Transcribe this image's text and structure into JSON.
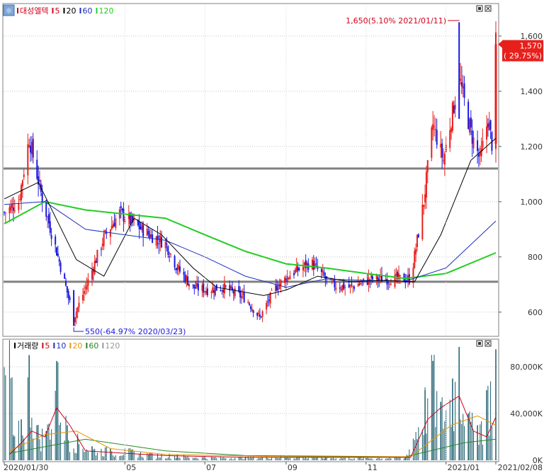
{
  "price_panel": {
    "legend": [
      {
        "label": "대성엘텍",
        "color": "#d0021b"
      },
      {
        "label": "5",
        "color": "#d0021b"
      },
      {
        "label": "20",
        "color": "#000000"
      },
      {
        "label": "60",
        "color": "#1f2fbf"
      },
      {
        "label": "120",
        "color": "#22cc22"
      }
    ],
    "y_ticks": [
      "1,600",
      "1,400",
      "1,200",
      "1,000",
      "800",
      "600"
    ],
    "high_annotation": "1,650(5.10% 2021/01/11)",
    "low_annotation": "550(-64.97% 2020/03/23)",
    "current_price": "1,570",
    "current_change": "( 29.75%)",
    "colors": {
      "up": "#e8201c",
      "down": "#1a1ae0",
      "ma5": "#d0021b",
      "ma20": "#000000",
      "ma60": "#1f2fbf",
      "ma120": "#22cc22",
      "support_line": "#808080"
    }
  },
  "volume_panel": {
    "legend": [
      {
        "label": "거래량",
        "color": "#000000"
      },
      {
        "label": "5",
        "color": "#d0021b"
      },
      {
        "label": "10",
        "color": "#1f2fbf"
      },
      {
        "label": "20",
        "color": "#e69500"
      },
      {
        "label": "60",
        "color": "#228b22"
      },
      {
        "label": "120",
        "color": "#999999"
      }
    ],
    "y_ticks": [
      "80,000K",
      "40,000K",
      "0K"
    ]
  },
  "x_axis": {
    "ticks": [
      "2020/01/30",
      "05",
      "07",
      "09",
      "11",
      "2021/01",
      "2021/02/08"
    ]
  },
  "chart_data": {
    "type": "candlestick",
    "title": "대성엘텍",
    "x_range": [
      "2020/01/30",
      "2021/02/08"
    ],
    "y_range": [
      520,
      1710
    ],
    "horizontal_lines": [
      1120,
      710
    ],
    "high": {
      "value": 1650,
      "date": "2021/01/11",
      "change_pct": 5.1
    },
    "low": {
      "value": 550,
      "date": "2020/03/23",
      "change_pct": -64.97
    },
    "last": {
      "value": 1570,
      "change_pct": 29.75
    },
    "price_path": [
      {
        "date": "2020/01/30",
        "close": 960
      },
      {
        "date": "2020/02/10",
        "close": 1000
      },
      {
        "date": "2020/02/18",
        "close": 1230
      },
      {
        "date": "2020/02/28",
        "close": 1010
      },
      {
        "date": "2020/03/10",
        "close": 820
      },
      {
        "date": "2020/03/23",
        "close": 580
      },
      {
        "date": "2020/04/02",
        "close": 700
      },
      {
        "date": "2020/04/15",
        "close": 870
      },
      {
        "date": "2020/04/27",
        "close": 960
      },
      {
        "date": "2020/05/08",
        "close": 920
      },
      {
        "date": "2020/05/20",
        "close": 880
      },
      {
        "date": "2020/06/01",
        "close": 850
      },
      {
        "date": "2020/06/10",
        "close": 760
      },
      {
        "date": "2020/06/22",
        "close": 690
      },
      {
        "date": "2020/07/03",
        "close": 680
      },
      {
        "date": "2020/07/15",
        "close": 690
      },
      {
        "date": "2020/08/01",
        "close": 650
      },
      {
        "date": "2020/08/12",
        "close": 580
      },
      {
        "date": "2020/08/24",
        "close": 690
      },
      {
        "date": "2020/09/05",
        "close": 740
      },
      {
        "date": "2020/09/20",
        "close": 780
      },
      {
        "date": "2020/10/05",
        "close": 700
      },
      {
        "date": "2020/10/20",
        "close": 690
      },
      {
        "date": "2020/11/05",
        "close": 720
      },
      {
        "date": "2020/11/20",
        "close": 720
      },
      {
        "date": "2020/12/05",
        "close": 720
      },
      {
        "date": "2020/12/15",
        "close": 1000
      },
      {
        "date": "2020/12/22",
        "close": 1280
      },
      {
        "date": "2020/12/30",
        "close": 1150
      },
      {
        "date": "2021/01/11",
        "close": 1450
      },
      {
        "date": "2021/01/20",
        "close": 1250
      },
      {
        "date": "2021/01/27",
        "close": 1150
      },
      {
        "date": "2021/02/02",
        "close": 1300
      },
      {
        "date": "2021/02/05",
        "close": 1210
      },
      {
        "date": "2021/02/08",
        "close": 1570
      }
    ],
    "moving_averages": {
      "ma20": [
        {
          "date": "2020/01/30",
          "value": 1010
        },
        {
          "date": "2020/02/25",
          "value": 1070
        },
        {
          "date": "2020/03/25",
          "value": 790
        },
        {
          "date": "2020/04/15",
          "value": 730
        },
        {
          "date": "2020/05/08",
          "value": 940
        },
        {
          "date": "2020/05/29",
          "value": 880
        },
        {
          "date": "2020/06/22",
          "value": 760
        },
        {
          "date": "2020/07/10",
          "value": 690
        },
        {
          "date": "2020/08/15",
          "value": 660
        },
        {
          "date": "2020/09/01",
          "value": 680
        },
        {
          "date": "2020/09/25",
          "value": 730
        },
        {
          "date": "2020/10/20",
          "value": 710
        },
        {
          "date": "2020/11/15",
          "value": 715
        },
        {
          "date": "2020/12/08",
          "value": 710
        },
        {
          "date": "2020/12/28",
          "value": 880
        },
        {
          "date": "2021/01/20",
          "value": 1150
        },
        {
          "date": "2021/02/08",
          "value": 1230
        }
      ],
      "ma60": [
        {
          "date": "2020/01/30",
          "value": 990
        },
        {
          "date": "2020/03/01",
          "value": 1000
        },
        {
          "date": "2020/04/01",
          "value": 900
        },
        {
          "date": "2020/05/01",
          "value": 880
        },
        {
          "date": "2020/06/01",
          "value": 860
        },
        {
          "date": "2020/07/01",
          "value": 800
        },
        {
          "date": "2020/08/01",
          "value": 730
        },
        {
          "date": "2020/09/01",
          "value": 690
        },
        {
          "date": "2020/10/01",
          "value": 720
        },
        {
          "date": "2020/11/01",
          "value": 715
        },
        {
          "date": "2020/12/01",
          "value": 712
        },
        {
          "date": "2021/01/01",
          "value": 760
        },
        {
          "date": "2021/02/08",
          "value": 930
        }
      ],
      "ma120": [
        {
          "date": "2020/01/30",
          "value": 920
        },
        {
          "date": "2020/03/01",
          "value": 1000
        },
        {
          "date": "2020/04/01",
          "value": 970
        },
        {
          "date": "2020/05/01",
          "value": 955
        },
        {
          "date": "2020/06/01",
          "value": 940
        },
        {
          "date": "2020/07/01",
          "value": 880
        },
        {
          "date": "2020/08/01",
          "value": 820
        },
        {
          "date": "2020/09/01",
          "value": 775
        },
        {
          "date": "2020/10/01",
          "value": 760
        },
        {
          "date": "2020/11/01",
          "value": 740
        },
        {
          "date": "2020/12/01",
          "value": 722
        },
        {
          "date": "2021/01/01",
          "value": 740
        },
        {
          "date": "2021/02/08",
          "value": 815
        }
      ]
    },
    "volume": {
      "unit": "K",
      "y_range": [
        0,
        100000
      ],
      "bars": [
        {
          "date": "2020/02/06",
          "value": 20000
        },
        {
          "date": "2020/02/12",
          "value": 35000
        },
        {
          "date": "2020/02/18",
          "value": 90000
        },
        {
          "date": "2020/02/24",
          "value": 30000
        },
        {
          "date": "2020/03/02",
          "value": 25000
        },
        {
          "date": "2020/03/10",
          "value": 85000
        },
        {
          "date": "2020/03/18",
          "value": 30000
        },
        {
          "date": "2020/03/26",
          "value": 20000
        },
        {
          "date": "2020/04/06",
          "value": 12000
        },
        {
          "date": "2020/04/20",
          "value": 10000
        },
        {
          "date": "2020/05/06",
          "value": 9000
        },
        {
          "date": "2020/05/20",
          "value": 6000
        },
        {
          "date": "2020/06/10",
          "value": 5000
        },
        {
          "date": "2020/07/01",
          "value": 3000
        },
        {
          "date": "2020/08/01",
          "value": 3000
        },
        {
          "date": "2020/09/01",
          "value": 4000
        },
        {
          "date": "2020/10/01",
          "value": 3000
        },
        {
          "date": "2020/11/01",
          "value": 2500
        },
        {
          "date": "2020/12/01",
          "value": 3000
        },
        {
          "date": "2020/12/16",
          "value": 60000
        },
        {
          "date": "2020/12/22",
          "value": 85000
        },
        {
          "date": "2020/12/28",
          "value": 50000
        },
        {
          "date": "2021/01/06",
          "value": 70000
        },
        {
          "date": "2021/01/11",
          "value": 97000
        },
        {
          "date": "2021/01/18",
          "value": 40000
        },
        {
          "date": "2021/01/25",
          "value": 30000
        },
        {
          "date": "2021/02/01",
          "value": 60000
        },
        {
          "date": "2021/02/08",
          "value": 95000
        }
      ],
      "ma5": [
        {
          "date": "2020/02/03",
          "value": 5000
        },
        {
          "date": "2020/02/12",
          "value": 15000
        },
        {
          "date": "2020/02/20",
          "value": 25000
        },
        {
          "date": "2020/03/01",
          "value": 20000
        },
        {
          "date": "2020/03/10",
          "value": 45000
        },
        {
          "date": "2020/03/20",
          "value": 30000
        },
        {
          "date": "2020/04/01",
          "value": 8000
        },
        {
          "date": "2020/05/01",
          "value": 6000
        },
        {
          "date": "2020/06/01",
          "value": 4000
        },
        {
          "date": "2020/08/01",
          "value": 2500
        },
        {
          "date": "2020/10/01",
          "value": 2500
        },
        {
          "date": "2020/12/05",
          "value": 2500
        },
        {
          "date": "2020/12/18",
          "value": 35000
        },
        {
          "date": "2020/12/28",
          "value": 45000
        },
        {
          "date": "2021/01/11",
          "value": 55000
        },
        {
          "date": "2021/01/22",
          "value": 25000
        },
        {
          "date": "2021/02/01",
          "value": 20000
        },
        {
          "date": "2021/02/08",
          "value": 37000
        }
      ],
      "ma20": [
        {
          "date": "2020/02/03",
          "value": 8000
        },
        {
          "date": "2020/03/01",
          "value": 22000
        },
        {
          "date": "2020/03/25",
          "value": 25000
        },
        {
          "date": "2020/04/20",
          "value": 10000
        },
        {
          "date": "2020/06/01",
          "value": 5000
        },
        {
          "date": "2020/09/01",
          "value": 3000
        },
        {
          "date": "2020/12/05",
          "value": 3000
        },
        {
          "date": "2021/01/05",
          "value": 30000
        },
        {
          "date": "2021/01/25",
          "value": 38000
        },
        {
          "date": "2021/02/08",
          "value": 30000
        }
      ],
      "ma60": [
        {
          "date": "2020/02/03",
          "value": 6000
        },
        {
          "date": "2020/04/01",
          "value": 18000
        },
        {
          "date": "2020/06/01",
          "value": 8000
        },
        {
          "date": "2020/08/01",
          "value": 4000
        },
        {
          "date": "2020/12/01",
          "value": 3000
        },
        {
          "date": "2021/01/15",
          "value": 15000
        },
        {
          "date": "2021/02/08",
          "value": 18000
        }
      ]
    }
  }
}
